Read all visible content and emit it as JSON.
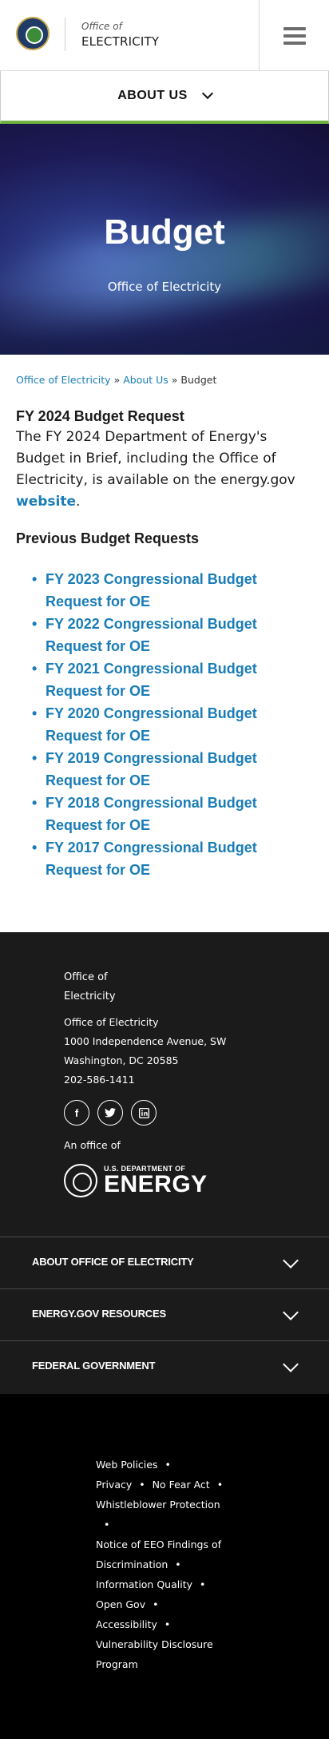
{
  "header": {
    "office_of": "Office of",
    "office_name": "ELECTRICITY"
  },
  "nav": {
    "about_us": "ABOUT US"
  },
  "hero": {
    "title": "Budget",
    "subtitle": "Office of Electricity"
  },
  "breadcrumb": {
    "items": [
      "Office of Electricity",
      "About Us"
    ],
    "separator": "»",
    "current": "Budget"
  },
  "fy2024": {
    "heading": "FY 2024 Budget Request",
    "text_before": "The FY 2024 Department of Energy's Budget in Brief, including the Office of Electricity, is available on the energy.gov ",
    "link": "website",
    "text_after": "."
  },
  "previous": {
    "heading": "Previous Budget Requests",
    "items": [
      "FY 2023 Congressional Budget Request for OE",
      "FY 2022 Congressional Budget Request for OE",
      "FY 2021 Congressional Budget Request for OE",
      "FY 2020 Congressional Budget Request for OE",
      "FY 2019 Congressional Budget Request for OE",
      "FY 2018 Congressional Budget Request for OE",
      "FY 2017 Congressional Budget Request for OE"
    ]
  },
  "footer": {
    "office_line1": "Office of",
    "office_line2": "Electricity",
    "address": [
      "Office of Electricity",
      "1000 Independence Avenue, SW",
      "Washington, DC 20585",
      "202-586-1411"
    ],
    "social_icons": [
      "facebook-icon",
      "twitter-icon",
      "linkedin-icon"
    ],
    "an_office_of": "An office of",
    "doe_small": "U.S. DEPARTMENT OF",
    "doe_big": "ENERGY",
    "accordions": [
      "ABOUT OFFICE OF ELECTRICITY",
      "ENERGY.GOV RESOURCES",
      "FEDERAL GOVERNMENT"
    ],
    "bottom_links": [
      "Web Policies",
      "Privacy",
      "No Fear Act",
      "Whistleblower Protection",
      "Notice of EEO Findings of Discrimination",
      "Information Quality",
      "Open Gov",
      "Accessibility",
      "Vulnerability Disclosure Program"
    ],
    "separator": "•"
  },
  "colors": {
    "link": "#1a7db7",
    "accent_green": "#6fb43f",
    "footer_bg": "#1b1b1b",
    "bottom_bg": "#000000"
  }
}
